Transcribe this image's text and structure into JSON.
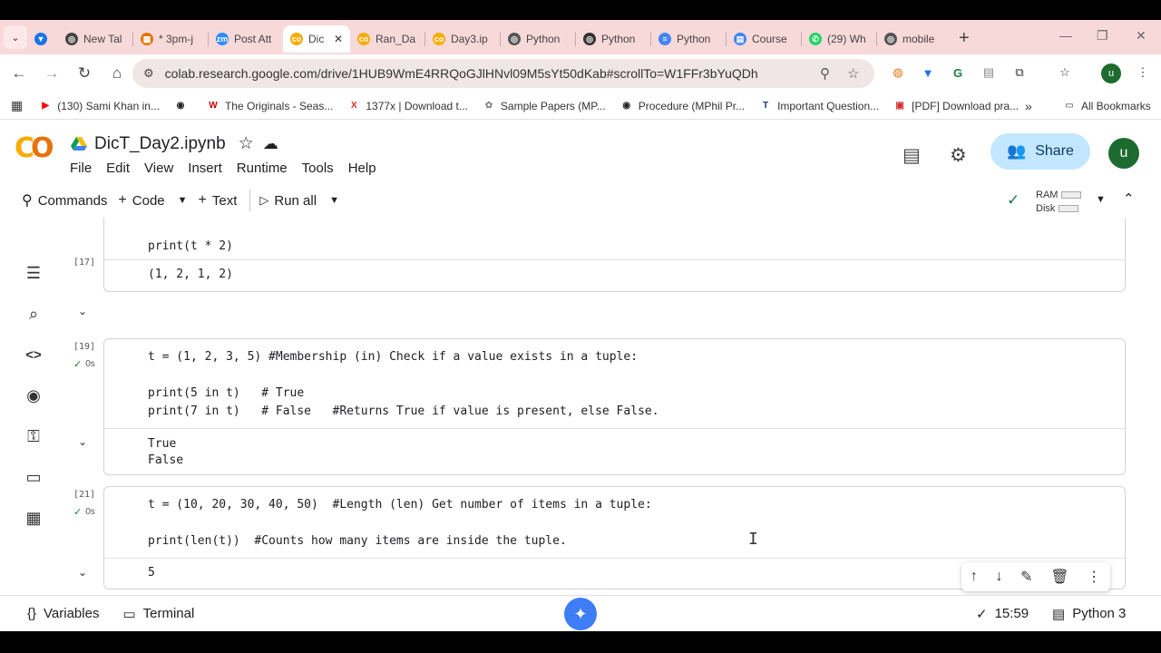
{
  "browser": {
    "tabs": [
      {
        "title": "New Tal",
        "color": "#444444",
        "glyph": "◎"
      },
      {
        "title": "* 3pm-j",
        "color": "#e37400",
        "glyph": "▦"
      },
      {
        "title": "Post Att",
        "color": "#2d8cff",
        "glyph": "zm"
      },
      {
        "title": "Dic",
        "color": "#f9ab00",
        "glyph": "co",
        "active": true
      },
      {
        "title": "Ran_Da",
        "color": "#f9ab00",
        "glyph": "co"
      },
      {
        "title": "Day3.ip",
        "color": "#f9ab00",
        "glyph": "co"
      },
      {
        "title": "Python",
        "color": "#555555",
        "glyph": "◎"
      },
      {
        "title": "Python",
        "color": "#333333",
        "glyph": "◎"
      },
      {
        "title": "Python",
        "color": "#4285f4",
        "glyph": "≡"
      },
      {
        "title": "Course",
        "color": "#4285f4",
        "glyph": "▤"
      },
      {
        "title": "(29) Wh",
        "color": "#25d366",
        "glyph": "✆"
      },
      {
        "title": "mobile",
        "color": "#555555",
        "glyph": "◎"
      }
    ],
    "url": "colab.research.google.com/drive/1HUB9WmE4RRQoGJlHNvl09M5sYt50dKab#scrollTo=W1FFr3bYuQDh",
    "bookmarks": [
      {
        "label": "(130) Sami Khan in...",
        "color": "#ff0000",
        "glyph": "▶"
      },
      {
        "label": "",
        "color": "#222222",
        "glyph": "◉"
      },
      {
        "label": "The Originals - Seas...",
        "color": "#c00000",
        "glyph": "W"
      },
      {
        "label": "1377x | Download t...",
        "color": "#d62d20",
        "glyph": "X"
      },
      {
        "label": "Sample Papers (MP...",
        "color": "#888888",
        "glyph": "✿"
      },
      {
        "label": "Procedure (MPhil Pr...",
        "color": "#222222",
        "glyph": "◉"
      },
      {
        "label": "Important Question...",
        "color": "#1a3a8a",
        "glyph": "T"
      },
      {
        "label": "[PDF] Download pra...",
        "color": "#d32f2f",
        "glyph": "▣"
      }
    ],
    "all_bookmarks": "All Bookmarks"
  },
  "colab": {
    "notebook_title": "DicT_Day2.ipynb",
    "menu": [
      "File",
      "Edit",
      "View",
      "Insert",
      "Runtime",
      "Tools",
      "Help"
    ],
    "share_label": "Share",
    "avatar_letter": "u",
    "toolbar": {
      "commands": "Commands",
      "code": "Code",
      "text": "Text",
      "run_all": "Run all",
      "ram": "RAM",
      "disk": "Disk"
    },
    "cells": [
      {
        "exec": "[17]",
        "time": "",
        "code": [
          "print(t * 2)"
        ],
        "output": [
          "(1, 2, 1, 2)"
        ]
      },
      {
        "exec": "[19]",
        "time": "0s",
        "code": [
          "t = (1, 2, 3, 5) #Membership (in) Check if a value exists in a tuple:",
          "",
          "print(5 in t)   # True",
          "print(7 in t)   # False   #Returns True if value is present, else False."
        ],
        "output": [
          "True",
          "False"
        ]
      },
      {
        "exec": "[21]",
        "time": "0s",
        "code": [
          "t = (10, 20, 30, 40, 50)  #Length (len) Get number of items in a tuple:",
          "",
          "print(len(t))  #Counts how many items are inside the tuple."
        ],
        "output": [
          "5"
        ]
      }
    ],
    "status": {
      "variables": "Variables",
      "terminal": "Terminal",
      "time": "15:59",
      "runtime": "Python 3"
    }
  }
}
